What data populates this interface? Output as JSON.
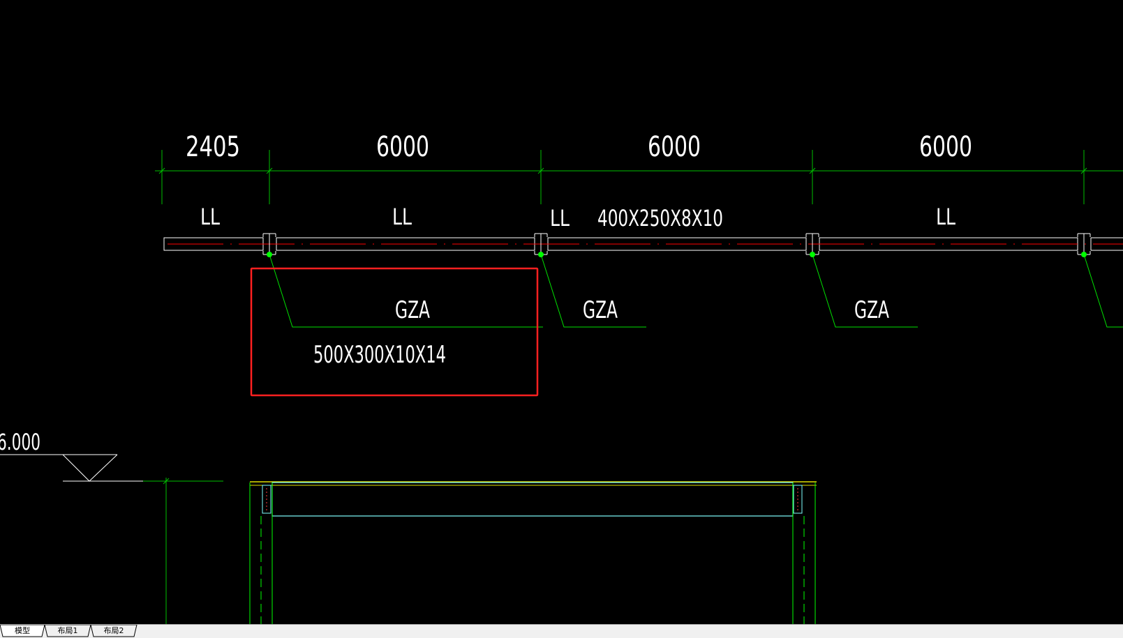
{
  "drawing": {
    "dimensions": [
      "2405",
      "6000",
      "6000",
      "6000"
    ],
    "beam_labels": [
      "LL",
      "LL",
      "LL",
      "400X250X8X10",
      "LL"
    ],
    "column_labels": [
      "GZA",
      "GZA",
      "GZA"
    ],
    "highlighted_section": "500X300X10X14",
    "elevation": "6.000"
  },
  "layout_tabs": [
    {
      "label": "模型",
      "active": true
    },
    {
      "label": "布局1",
      "active": false
    },
    {
      "label": "布局2",
      "active": false
    }
  ],
  "colors": {
    "background": "#000000",
    "dimension_line": "#00c000",
    "beam_outline": "#ffffff",
    "center_line": "#ff0000",
    "highlight_box": "#ff2020",
    "elevation_beam": "#80ffff",
    "column_line": "#00ff00"
  }
}
